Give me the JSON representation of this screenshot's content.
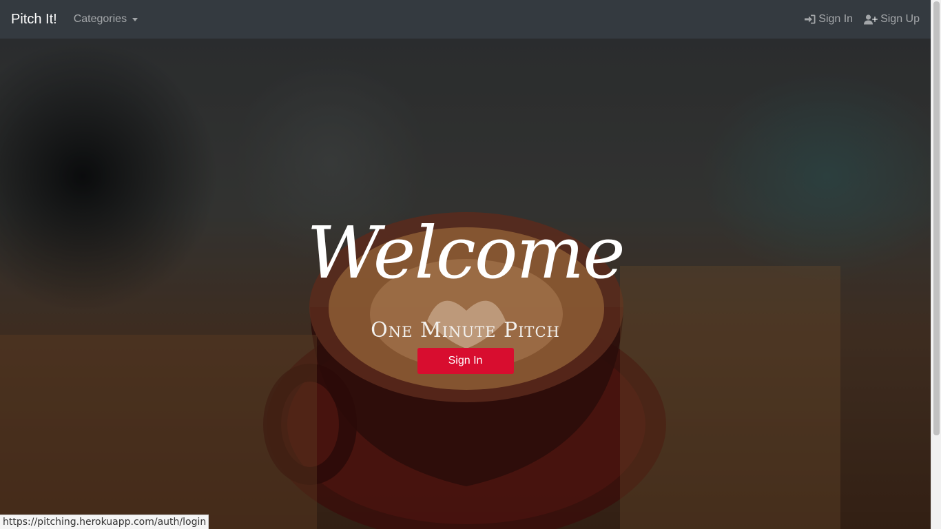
{
  "navbar": {
    "brand": "Pitch It!",
    "categories_label": "Categories",
    "sign_in_label": "Sign In",
    "sign_up_label": "Sign Up",
    "background_color": "#343a40"
  },
  "hero": {
    "title": "Welcome",
    "subtitle": "One Minute Pitch",
    "button_label": "Sign In",
    "button_color": "#d80d2f"
  },
  "status_bar": {
    "url": "https://pitching.herokuapp.com/auth/login"
  },
  "icons": [
    "sign-in-icon",
    "user-plus-icon",
    "dropdown-caret-icon"
  ]
}
